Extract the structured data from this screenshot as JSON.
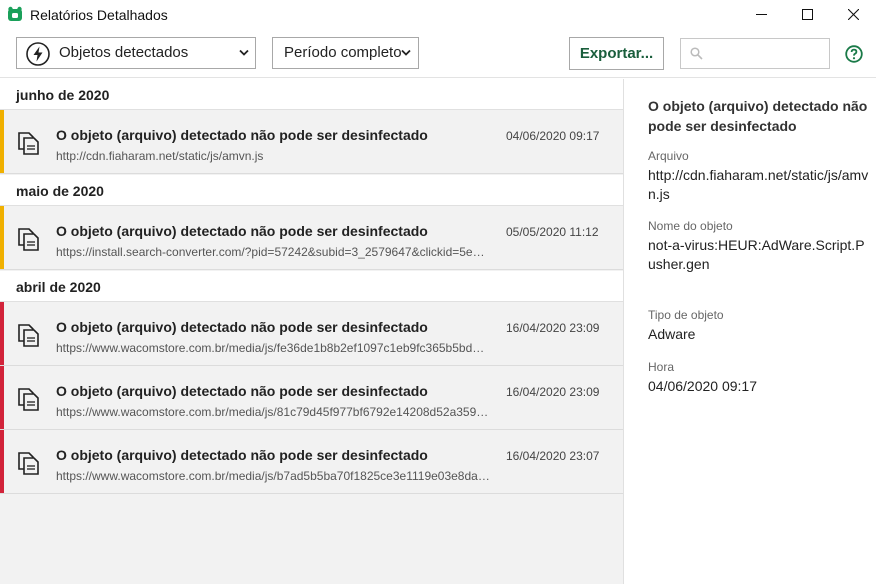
{
  "window": {
    "title": "Relatórios Detalhados",
    "brand_color": "#1aa05a"
  },
  "toolbar": {
    "objects_filter": "Objetos detectados",
    "period_filter": "Período completo",
    "export_label": "Exportar...",
    "search_placeholder": ""
  },
  "groups": [
    {
      "label": "junho de 2020"
    },
    {
      "label": "maio de 2020"
    },
    {
      "label": "abril de 2020"
    }
  ],
  "entries": [
    {
      "title": "O objeto (arquivo) detectado não pode ser desinfectado",
      "url": "http://cdn.fiaharam.net/static/js/amvn.js",
      "time": "04/06/2020 09:17",
      "severity_color": "#f0b000"
    },
    {
      "title": "O objeto (arquivo) detectado não pode ser desinfectado",
      "url": "https://install.search-converter.com/?pid=57242&subid=3_2579647&clickid=5e…",
      "time": "05/05/2020 11:12",
      "severity_color": "#f0b000"
    },
    {
      "title": "O objeto (arquivo) detectado não pode ser desinfectado",
      "url": "https://www.wacomstore.com.br/media/js/fe36de1b8b2ef1097c1eb9fc365b5bd…",
      "time": "16/04/2020 23:09",
      "severity_color": "#d2233a"
    },
    {
      "title": "O objeto (arquivo) detectado não pode ser desinfectado",
      "url": "https://www.wacomstore.com.br/media/js/81c79d45f977bf6792e14208d52a359…",
      "time": "16/04/2020 23:09",
      "severity_color": "#d2233a"
    },
    {
      "title": "O objeto (arquivo) detectado não pode ser desinfectado",
      "url": "https://www.wacomstore.com.br/media/js/b7ad5b5ba70f1825ce3e1119e03e8da…",
      "time": "16/04/2020 23:07",
      "severity_color": "#d2233a"
    }
  ],
  "details": {
    "title": "O objeto (arquivo) detectado não pode ser desinfectado",
    "file_label": "Arquivo",
    "file_value": "http://cdn.fiaharam.net/static/js/amvn.js",
    "object_name_label": "Nome do objeto",
    "object_name_value": "not-a-virus:HEUR:AdWare.Script.Pusher.gen",
    "object_type_label": "Tipo de objeto",
    "object_type_value": "Adware",
    "time_label": "Hora",
    "time_value": "04/06/2020 09:17"
  },
  "icons": {
    "app": "kaspersky-bear-icon",
    "objects_filter": "lightning-icon",
    "caret": "chevron-down-icon",
    "search": "search-icon",
    "help": "help-icon",
    "entry": "document-copy-icon",
    "minimize": "minimize-icon",
    "maximize": "maximize-icon",
    "close": "close-icon"
  }
}
